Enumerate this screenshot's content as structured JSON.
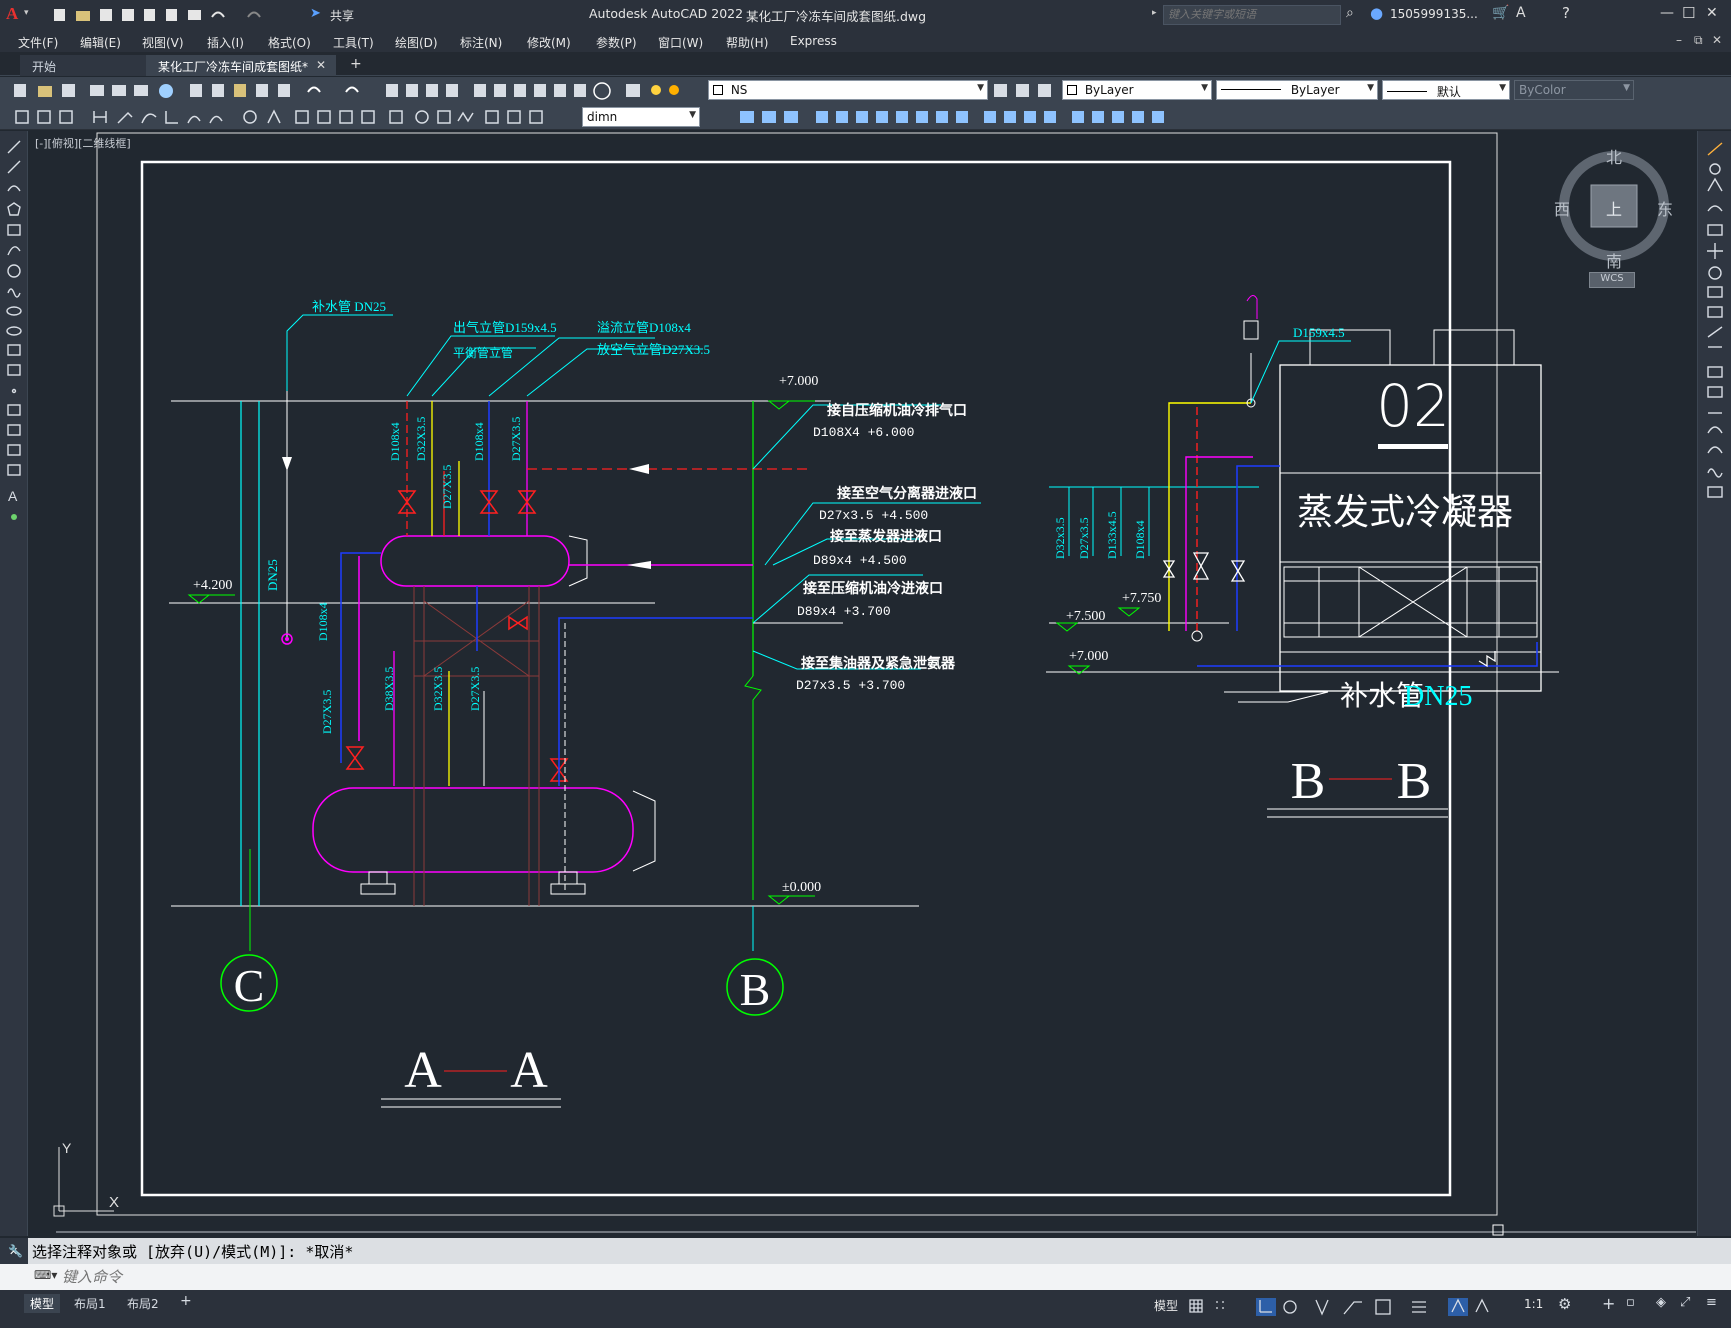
{
  "titlebar": {
    "app_name": "Autodesk AutoCAD 2022",
    "file_name": "某化工厂冷冻车间成套图纸.dwg",
    "share_label": "共享",
    "search_placeholder": "键入关键字或短语",
    "user_name": "1505999135...",
    "min_icon": "—",
    "max_icon": "☐",
    "close_icon": "✕"
  },
  "menu": [
    "文件(F)",
    "编辑(E)",
    "视图(V)",
    "插入(I)",
    "格式(O)",
    "工具(T)",
    "绘图(D)",
    "标注(N)",
    "修改(M)",
    "参数(P)",
    "窗口(W)",
    "帮助(H)",
    "Express"
  ],
  "tabs": {
    "start": "开始",
    "drawing": "某化工厂冷冻车间成套图纸*",
    "close": "✕",
    "add": "+"
  },
  "toolbar": {
    "layer": "NS",
    "color": "ByLayer",
    "linetype": "ByLayer",
    "lineweight": "默认",
    "plotstyle": "ByColor",
    "dimstyle": "dimn"
  },
  "viewport_label": "[-][俯视][二维线框]",
  "viewcube": {
    "north": "北",
    "south": "南",
    "east": "东",
    "west": "西",
    "top": "上",
    "wcs": "WCS"
  },
  "ucs": {
    "x": "X",
    "y": "Y"
  },
  "drawing": {
    "section_aa": {
      "left": "A",
      "right": "A"
    },
    "section_bb": {
      "left": "B",
      "right": "B"
    },
    "axis_c": "C",
    "axis_b": "B",
    "aa_levels": [
      "+7.000",
      "+4.200",
      "±0.000"
    ],
    "bb_levels": [
      "+7.750",
      "+7.500",
      "+7.000"
    ],
    "aa_top_labels": [
      "补水管 DN25",
      "出气立管D159x4.5",
      "溢流立管D108x4",
      "平衡管立管",
      "放空气立管D27X3.5"
    ],
    "aa_connections": [
      {
        "title": "接自压缩机油冷排气口",
        "spec": "D108X4 +6.000"
      },
      {
        "title": "接至空气分离器进液口",
        "spec": "D27x3.5 +4.500"
      },
      {
        "title": "接至蒸发器进液口",
        "spec": "D89x4 +4.500"
      },
      {
        "title": "接至压缩机油冷进液口",
        "spec": "D89x4 +3.700"
      },
      {
        "title": "接至集油器及紧急泄氨器",
        "spec": "D27x3.5 +3.700"
      }
    ],
    "aa_vertical_labels": [
      "D108x4",
      "D32X3.5",
      "D108x4",
      "D27X3.5",
      "D27X3.5",
      "DN25",
      "D108x4",
      "D27X3.5",
      "D38X3.5",
      "D32X3.5",
      "D27X3.5"
    ],
    "bb_vertical_labels": [
      "D32x3.5",
      "D27x3.5",
      "D133x4.5",
      "D108x4"
    ],
    "bb_top_spec": "D159x4.5",
    "condenser_number": "02",
    "condenser_name": "蒸发式冷凝器",
    "makeup_water": "补水管",
    "makeup_dn": "DN25"
  },
  "command": {
    "history": "选择注释对象或 [放弃(U)/模式(M)]: *取消*",
    "placeholder": "键入命令"
  },
  "layout_tabs": [
    "模型",
    "布局1",
    "布局2"
  ],
  "status": {
    "model": "模型",
    "scale": "1:1"
  },
  "colors": {
    "canvas": "#212830",
    "cyan": "#00ffff",
    "red": "#ff2020",
    "magenta": "#ff00ff",
    "blue": "#1e3cff",
    "green": "#00d000",
    "yellow": "#ffff00",
    "white": "#ffffff"
  }
}
